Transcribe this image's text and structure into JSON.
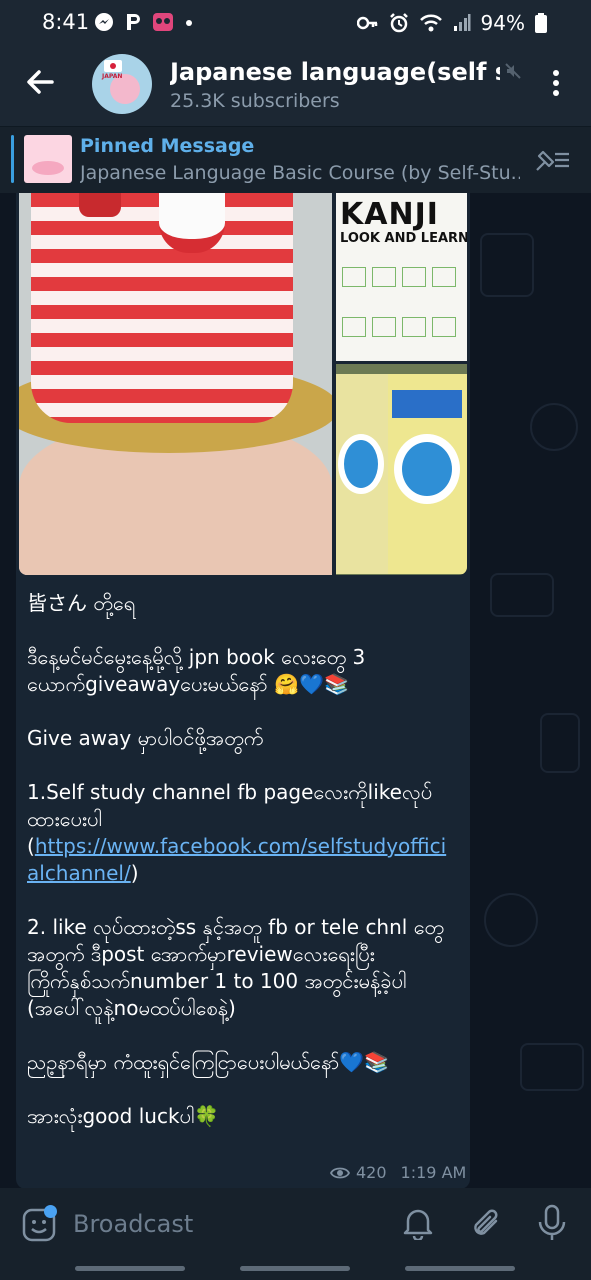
{
  "status_bar": {
    "time": "8:41",
    "battery": "94%",
    "left_icons": [
      "messenger-icon",
      "p-app-icon",
      "panda-icon",
      "notification-dot"
    ],
    "right_icons": [
      "key-icon",
      "alarm-icon",
      "wifi-icon",
      "signal-icon",
      "battery-icon"
    ]
  },
  "header": {
    "title": "Japanese language(self st...",
    "subtitle": "25.3K subscribers",
    "avatar_label": "JAPAN"
  },
  "pinned": {
    "title": "Pinned Message",
    "text": "Japanese Language  Basic Course (by Self-Stu..."
  },
  "message": {
    "kanji_cover": {
      "title": "KANJI",
      "subtitle": "LOOK AND LEARN"
    },
    "lines": [
      "皆さん တို့ရေ",
      "",
      "ဒီနေ့မင်မင်မွေးနေ့မို့လို့ jpn book လေးတွေ 3 ယောက်giveawayပေးမယ်နော် 🤗💙📚",
      "",
      "Give away မှာပါဝင်ဖို့အတွက်",
      "",
      "1.Self study channel fb pageလေးကိုlikeလုပ်ထားပေးပါ"
    ],
    "link_open": "(",
    "link_text": "https://www.facebook.com/selfstudyofficialchannel/",
    "link_close": ")",
    "lines2": [
      "",
      "2. like လုပ်ထားတဲ့ss နှင့်အတူ fb or tele chnl တွေအတွက် ဒီpost အောက်မှာreviewလေးရေးပြီး ကြိုက်နှစ်သက်number 1 to 100 အတွင်းမန့်ခဲ့ပါ",
      "(အပေါ်လူနဲ့noမထပ်ပါစေနဲ့)",
      "",
      "ညဉ့နာရီမှာ ကံထူးရှင်ကြေငြာပေးပါမယ်နော်💙📚",
      "",
      "အားလုံးgood luckပါ🍀"
    ],
    "views": "420",
    "time": "1:19 AM"
  },
  "composer": {
    "placeholder": "Broadcast"
  }
}
